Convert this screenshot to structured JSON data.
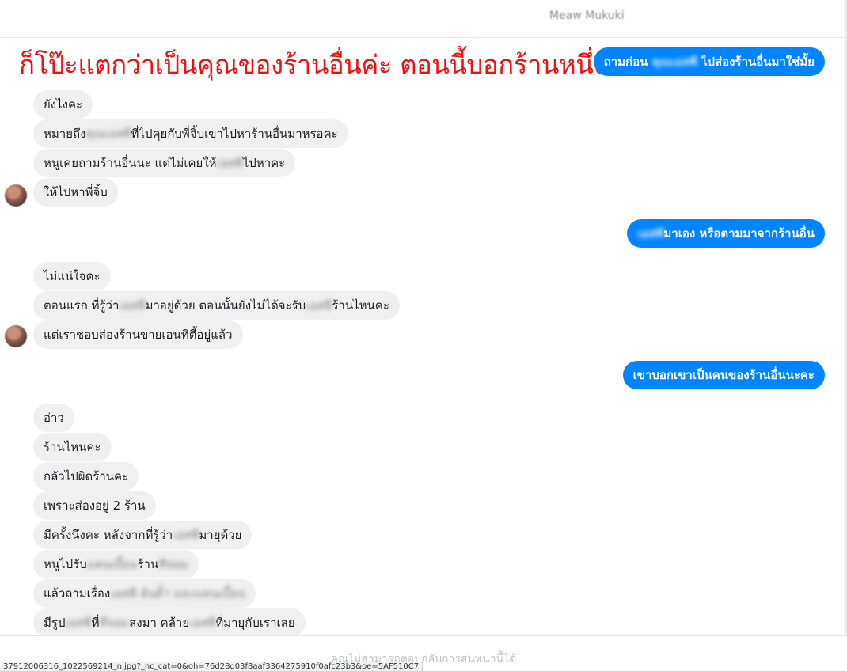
{
  "header": {
    "contact_name": "Meaw Mukuki"
  },
  "overlay": {
    "caption": "ก็โป๊ะแตกว่าเป็นคุณของร้านอื่นค่ะ ตอนนี้บอกร้านหนึ่ง"
  },
  "messages": {
    "o1": {
      "a": "ถามก่อน ",
      "b": "คุณเอสพี",
      "c": " ไปส่องร้านอื่นมาใช่มั้ย"
    },
    "i1": {
      "a": "ยังไงคะ"
    },
    "i2": {
      "a": "หมายถึง",
      "b": "คุณเอสพี",
      "c": "ที่ไปคุยกับพี่จิ้บเขาไปหาร้านอื่นมาหรอคะ"
    },
    "i3": {
      "a": "หนูเคยถามร้านอื่นนะ แต่ไม่เคยให้",
      "b": "เอสพี",
      "c": "ไปหาคะ"
    },
    "i4": {
      "a": "ให้ไปหาพี่จิ้บ"
    },
    "o2": {
      "b": "เอสพี",
      "c": "มาเอง หรือตามมาจากร้านอื่น"
    },
    "i5": {
      "a": "ไม่แน่ใจคะ"
    },
    "i6": {
      "a": "ตอนแรก ที่รู้ว่า",
      "b": "เอสพี",
      "c": "มาอยู่ด้วย ตอนนั้นยังไม่ได้จะรับ",
      "d": "เอสพี",
      "e": "ร้านไหนคะ"
    },
    "i7": {
      "a": "แต่เราชอบส่องร้านขายเอนทิตี้อยู่แล้ว"
    },
    "o3": {
      "a": "เขาบอกเขาเป็นคนของร้านอื่นนะคะ"
    },
    "i8": {
      "a": "อ่าว"
    },
    "i9": {
      "a": "ร้านไหนคะ"
    },
    "i10": {
      "a": "กลัวไปผิดร้านคะ"
    },
    "i11": {
      "a": "เพราะส่องอยู่ 2 ร้าน"
    },
    "i12": {
      "a": "มีครั้งนึงคะ หลังจากที่รู้ว่า",
      "b": "เอสพี",
      "c": "มายุด้วย"
    },
    "i13": {
      "a": "หนูไปรับ",
      "b": "แคนเบี้ยน",
      "c": "ร้าน",
      "d": "ทีจอม"
    },
    "i14": {
      "a": "แล้วถามเรื่อง",
      "b": "เอสพี อันติ้า และแคนเบี้ยน"
    },
    "i15": {
      "a": "มีรูป",
      "b": "เอสพี",
      "c": "ที่",
      "d": "ทีจอม",
      "e": "ส่งมา คล้าย",
      "f": "เอสพี",
      "g": "ที่มายุกับเราเลย"
    }
  },
  "footer": {
    "notice": "คุณไม่สามารถตอบกลับการสนทนานี้ได้"
  },
  "statusbar": {
    "url": "37912006316_1022569214_n.jpg?_nc_cat=0&oh=76d28d03f8aaf3364275910f0afc23b3&oe=5AF510C7"
  },
  "colors": {
    "outgoing_bubble": "#0084ff",
    "incoming_bubble": "#f1f0f0",
    "caption": "#ee1111"
  }
}
